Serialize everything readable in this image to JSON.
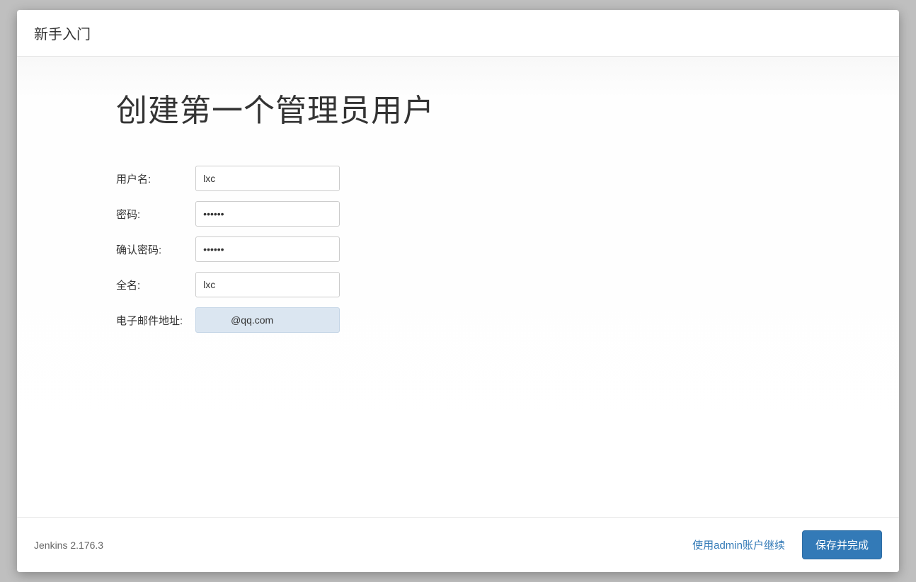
{
  "header": {
    "title": "新手入门"
  },
  "main": {
    "title": "创建第一个管理员用户",
    "form": {
      "username": {
        "label": "用户名:",
        "value": "lxc"
      },
      "password": {
        "label": "密码:",
        "value": "••••••"
      },
      "confirm": {
        "label": "确认密码:",
        "value": "••••••"
      },
      "fullname": {
        "label": "全名:",
        "value": "lxc"
      },
      "email": {
        "label": "电子邮件地址:",
        "value": "          @qq.com"
      }
    }
  },
  "footer": {
    "version": "Jenkins 2.176.3",
    "continue_as_admin": "使用admin账户继续",
    "save_and_finish": "保存并完成"
  }
}
